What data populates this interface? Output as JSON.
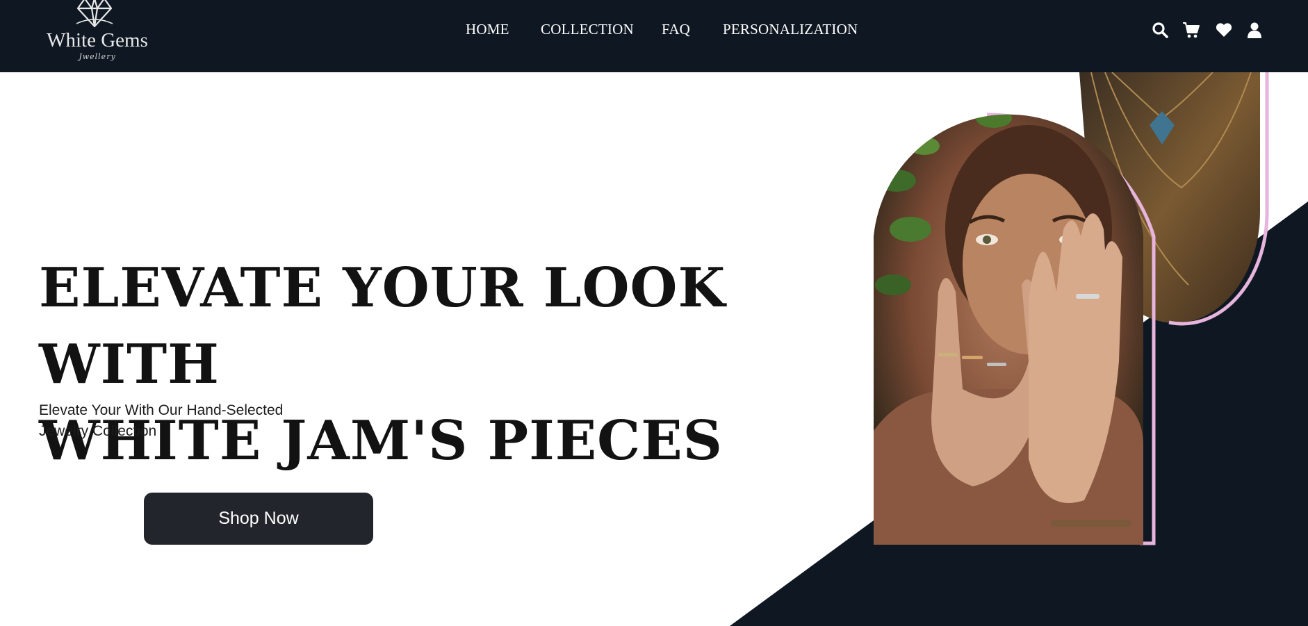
{
  "brand": {
    "name": "White Gems",
    "tagline": "Jwellery"
  },
  "nav": {
    "items": [
      "HOME",
      "COLLECTION",
      "FAQ",
      "PERSONALIZATION"
    ]
  },
  "icons": [
    "search-icon",
    "cart-icon",
    "heart-icon",
    "user-icon"
  ],
  "hero": {
    "title_line1": "ELEVATE YOUR LOOK WITH",
    "title_line2": "WHITE JAM'S PIECES",
    "subtitle_line1": "Elevate Your With Our Hand-Selected",
    "subtitle_line2": "Jewelry Collection",
    "cta": "Shop Now"
  },
  "colors": {
    "navbar": "#0f1822",
    "dark_panel": "#0f1822",
    "button": "#22262c",
    "accent_pink": "#e6b4dc",
    "text": "#121212"
  }
}
